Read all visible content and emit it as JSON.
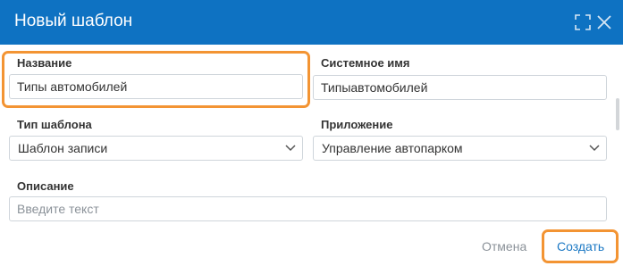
{
  "dialog": {
    "title": "Новый шаблон",
    "icons": {
      "expand": "expand-icon",
      "close": "close-icon"
    }
  },
  "form": {
    "name": {
      "label": "Название",
      "value": "Типы автомобилей"
    },
    "system_name": {
      "label": "Системное имя",
      "value": "Типыавтомобилей"
    },
    "template_type": {
      "label": "Тип шаблона",
      "value": "Шаблон записи"
    },
    "application": {
      "label": "Приложение",
      "value": "Управление автопарком"
    },
    "description": {
      "label": "Описание",
      "placeholder": "Введите текст",
      "value": ""
    }
  },
  "footer": {
    "cancel_label": "Отмена",
    "create_label": "Создать"
  },
  "colors": {
    "titlebar": "#0e72c2",
    "highlight": "#f39433",
    "primary_link": "#1b78c4",
    "muted_text": "#8b9299"
  }
}
